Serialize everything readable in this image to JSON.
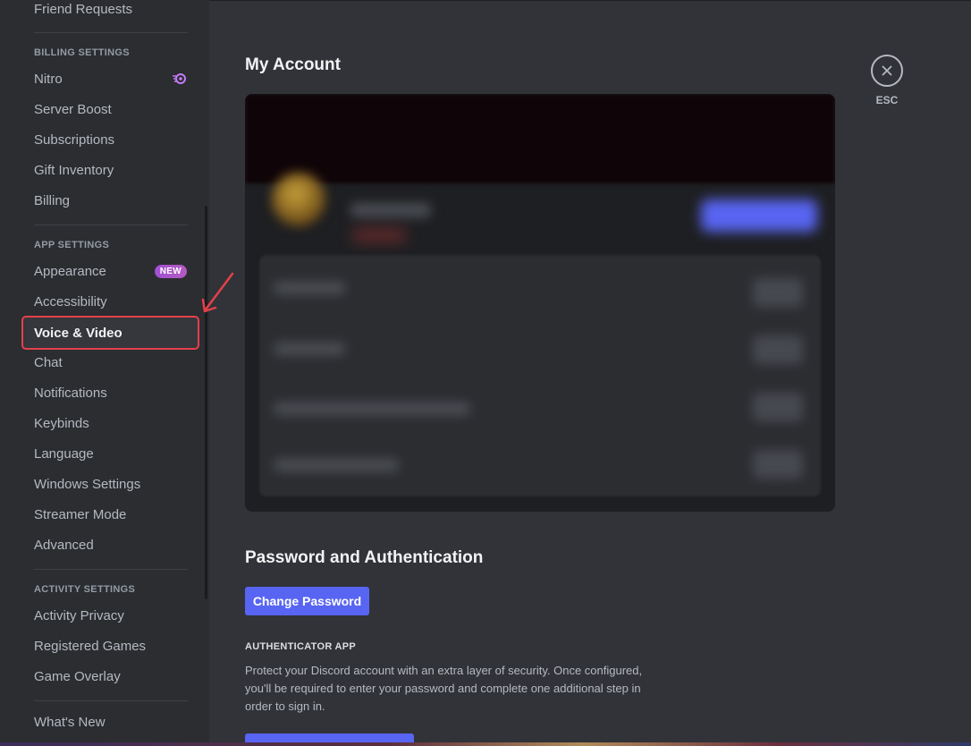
{
  "sidebar": {
    "top_item": "Friend Requests",
    "billing_header": "BILLING SETTINGS",
    "billing_items": [
      {
        "label": "Nitro",
        "icon": "nitro-icon"
      },
      {
        "label": "Server Boost"
      },
      {
        "label": "Subscriptions"
      },
      {
        "label": "Gift Inventory"
      },
      {
        "label": "Billing"
      }
    ],
    "app_header": "APP SETTINGS",
    "app_items": [
      {
        "label": "Appearance",
        "badge": "NEW"
      },
      {
        "label": "Accessibility"
      },
      {
        "label": "Voice & Video"
      },
      {
        "label": "Chat"
      },
      {
        "label": "Notifications"
      },
      {
        "label": "Keybinds"
      },
      {
        "label": "Language"
      },
      {
        "label": "Windows Settings"
      },
      {
        "label": "Streamer Mode"
      },
      {
        "label": "Advanced"
      }
    ],
    "activity_header": "ACTIVITY SETTINGS",
    "activity_items": [
      {
        "label": "Activity Privacy"
      },
      {
        "label": "Registered Games"
      },
      {
        "label": "Game Overlay"
      }
    ],
    "whats_new": "What's New"
  },
  "main": {
    "title": "My Account",
    "password_section_title": "Password and Authentication",
    "change_password_label": "Change Password",
    "authenticator_header": "AUTHENTICATOR APP",
    "authenticator_description": "Protect your Discord account with an extra layer of security. Once configured, you'll be required to enter your password and complete one additional step in order to sign in."
  },
  "close": {
    "label": "ESC",
    "icon": "close-icon"
  },
  "colors": {
    "accent": "#5865f2",
    "annotation": "#e5404a",
    "badge_new": "#a04fd4"
  }
}
